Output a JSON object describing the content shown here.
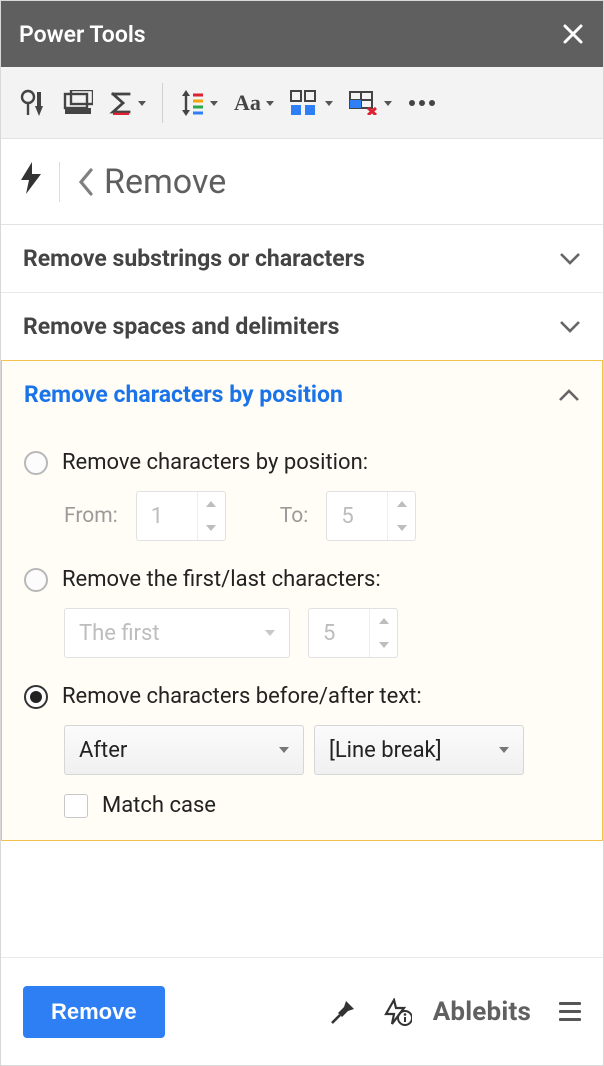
{
  "titlebar": {
    "title": "Power Tools"
  },
  "breadcrumb": {
    "page_title": "Remove"
  },
  "sections": {
    "s1": {
      "title": "Remove substrings or characters"
    },
    "s2": {
      "title": "Remove spaces and delimiters"
    },
    "s3": {
      "title": "Remove characters by position",
      "opt1_label": "Remove characters by position:",
      "from_label": "From:",
      "from_value": "1",
      "to_label": "To:",
      "to_value": "5",
      "opt2_label": "Remove the first/last characters:",
      "firstlast_value": "The first",
      "count2_value": "5",
      "opt3_label": "Remove characters before/after text:",
      "beforeafter_value": "After",
      "text_value": "[Line break]",
      "match_case_label": "Match case"
    }
  },
  "footer": {
    "primary_label": "Remove",
    "brand": "Ablebits"
  }
}
